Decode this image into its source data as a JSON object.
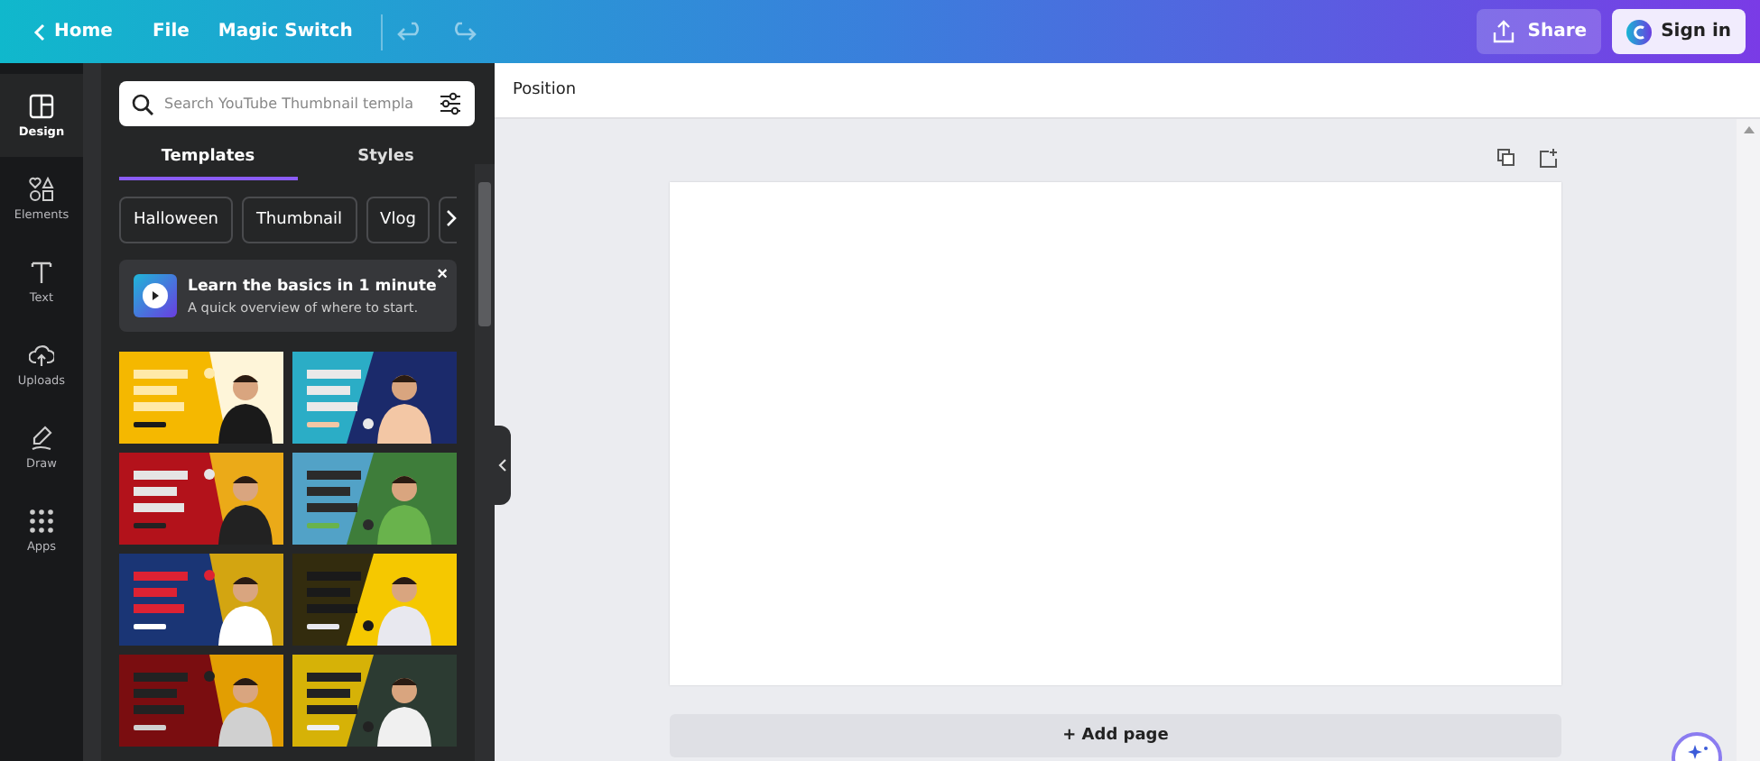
{
  "topbar": {
    "nav": [
      {
        "label": "Home",
        "kind": "back"
      },
      {
        "label": "File",
        "kind": "menu"
      },
      {
        "label": "Magic Switch",
        "kind": "menu"
      }
    ],
    "share": "Share",
    "sign_in": "Sign in"
  },
  "rail": [
    {
      "label": "Design",
      "kind": "layout",
      "selected": true
    },
    {
      "label": "Elements",
      "kind": "shapes",
      "selected": false
    },
    {
      "label": "Text",
      "kind": "text",
      "selected": false
    },
    {
      "label": "Uploads",
      "kind": "upload",
      "selected": false
    },
    {
      "label": "Draw",
      "kind": "pen",
      "selected": false
    },
    {
      "label": "Apps",
      "kind": "grid",
      "selected": false
    }
  ],
  "panel": {
    "search": {
      "placeholder": "Search YouTube Thumbnail templa"
    },
    "tabs": [
      {
        "label": "Templates",
        "selected": true
      },
      {
        "label": "Styles",
        "selected": false
      }
    ],
    "chips": [
      "Halloween",
      "Thumbnail",
      "Vlog"
    ],
    "promo": {
      "title": "Learn the basics in 1 minute",
      "subtitle": "A quick overview of where to start.",
      "close": "×"
    }
  },
  "editor": {
    "toolbar_label": "Position",
    "add_page": "+ Add page"
  }
}
